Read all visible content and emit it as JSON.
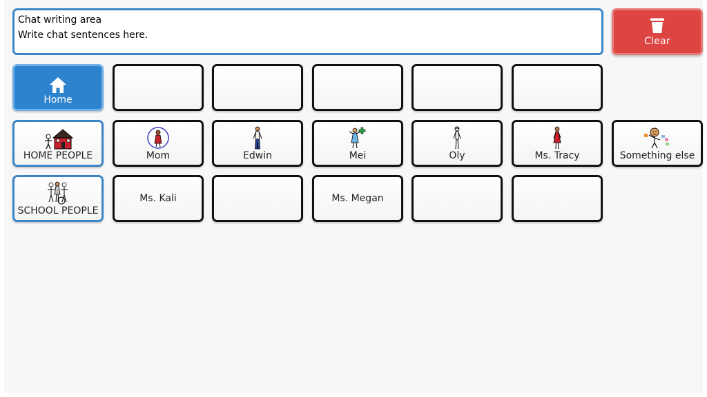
{
  "chat": {
    "line1": "Chat writing area",
    "line2": "Write chat sentences here."
  },
  "clear_button": {
    "label": "Clear",
    "icon": "trash-icon"
  },
  "grid": {
    "row1": {
      "home": {
        "label": "Home",
        "icon": "home-icon"
      }
    },
    "row2": {
      "home_people": {
        "label": "HOME PEOPLE",
        "icon": "house-with-person-icon"
      },
      "mom": {
        "label": "Mom",
        "icon": "mom-icon"
      },
      "edwin": {
        "label": "Edwin",
        "icon": "man-icon"
      },
      "mei": {
        "label": "Mei",
        "icon": "nurse-icon"
      },
      "oly": {
        "label": "Oly",
        "icon": "person-icon"
      },
      "ms_tracy": {
        "label": "Ms. Tracy",
        "icon": "woman-icon"
      },
      "something_else": {
        "label": "Something else",
        "icon": "person-with-items-icon"
      }
    },
    "row3": {
      "school_people": {
        "label": "SCHOOL PEOPLE",
        "icon": "group-of-people-icon"
      },
      "ms_kali": {
        "label": "Ms. Kali"
      },
      "ms_megan": {
        "label": "Ms. Megan"
      }
    }
  },
  "colors": {
    "accent_blue": "#3a86c8",
    "home_active": "#2e83cf",
    "clear_red": "#dc4542",
    "tile_border": "#111111"
  }
}
